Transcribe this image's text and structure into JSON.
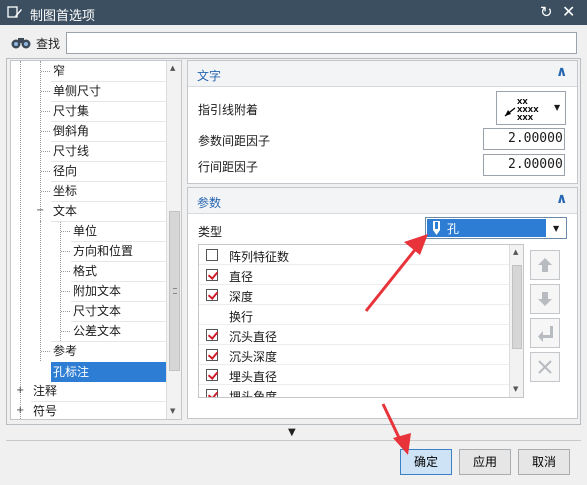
{
  "window": {
    "title": "制图首选项",
    "reset_icon": "reset-icon",
    "close_icon": "close-icon"
  },
  "search": {
    "label": "查找",
    "value": ""
  },
  "tree": {
    "items": [
      {
        "label": "窄",
        "indent": 1
      },
      {
        "label": "单侧尺寸",
        "indent": 1
      },
      {
        "label": "尺寸集",
        "indent": 1
      },
      {
        "label": "倒斜角",
        "indent": 1
      },
      {
        "label": "尺寸线",
        "indent": 1
      },
      {
        "label": "径向",
        "indent": 1
      },
      {
        "label": "坐标",
        "indent": 1
      },
      {
        "label": "文本",
        "indent": 1,
        "expanded": true
      },
      {
        "label": "单位",
        "indent": 2
      },
      {
        "label": "方向和位置",
        "indent": 2
      },
      {
        "label": "格式",
        "indent": 2
      },
      {
        "label": "附加文本",
        "indent": 2
      },
      {
        "label": "尺寸文本",
        "indent": 2
      },
      {
        "label": "公差文本",
        "indent": 2
      },
      {
        "label": "参考",
        "indent": 1
      },
      {
        "label": "孔标注",
        "indent": 1,
        "selected": true
      },
      {
        "label": "注释",
        "indent": 0,
        "collapsed": true
      },
      {
        "label": "符号",
        "indent": 0,
        "collapsed": true
      }
    ]
  },
  "text_section": {
    "title": "文字",
    "leader_label": "指引线附着",
    "param_gap_label": "参数间距因子",
    "param_gap_value": "2.00000",
    "line_gap_label": "行间距因子",
    "line_gap_value": "2.00000",
    "leader_glyph_text": "XX\nXXXX\nXXX"
  },
  "param_section": {
    "title": "参数",
    "type_label": "类型",
    "type_value": "孔",
    "items": [
      {
        "label": "阵列特征数",
        "checked": false
      },
      {
        "label": "直径",
        "checked": true
      },
      {
        "label": "深度",
        "checked": true
      },
      {
        "label": "换行",
        "checked": null
      },
      {
        "label": "沉头直径",
        "checked": true
      },
      {
        "label": "沉头深度",
        "checked": true
      },
      {
        "label": "埋头直径",
        "checked": true
      },
      {
        "label": "埋头角度",
        "checked": true
      }
    ],
    "side_buttons": [
      "move-up-icon",
      "move-down-icon",
      "insert-line-break-icon",
      "delete-icon"
    ]
  },
  "footer": {
    "ok": "确定",
    "apply": "应用",
    "cancel": "取消"
  },
  "colors": {
    "titlebar": "#3c4f60",
    "accent": "#2766b3",
    "selection": "#2c7dd3",
    "annotation_arrow": "#e8333b"
  }
}
